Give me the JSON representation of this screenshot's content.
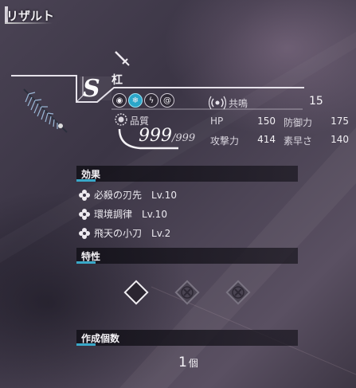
{
  "header": {
    "title": "リザルト"
  },
  "weapon": {
    "rank": "S",
    "name": "杠",
    "elements": [
      {
        "icon": "fire-icon",
        "glyph": "◉",
        "active": false
      },
      {
        "icon": "ice-icon",
        "glyph": "❄",
        "active": true
      },
      {
        "icon": "thunder-icon",
        "glyph": "ϟ",
        "active": false
      },
      {
        "icon": "wind-icon",
        "glyph": "@",
        "active": false
      }
    ],
    "quality_label": "品質",
    "quality_value": "999",
    "quality_max": "/999",
    "resonance_label": "共鳴",
    "resonance_value": "15",
    "stats": [
      {
        "label": "HP",
        "value": "150"
      },
      {
        "label": "防御力",
        "value": "175"
      },
      {
        "label": "攻撃力",
        "value": "414"
      },
      {
        "label": "素早さ",
        "value": "140"
      }
    ]
  },
  "effects_section": {
    "title": "効果",
    "items": [
      {
        "name": "必殺の刃先",
        "level": "Lv.10"
      },
      {
        "name": "環境調律",
        "level": "Lv.10"
      },
      {
        "name": "飛天の小刀",
        "level": "Lv.2"
      }
    ]
  },
  "traits_section": {
    "title": "特性",
    "slots": [
      {
        "state": "empty"
      },
      {
        "state": "locked"
      },
      {
        "state": "locked"
      }
    ]
  },
  "craft_section": {
    "title": "作成個数",
    "count": "1",
    "unit": "個"
  },
  "colors": {
    "accent": "#39a8c8",
    "ice_active": "#2aa6c9"
  }
}
